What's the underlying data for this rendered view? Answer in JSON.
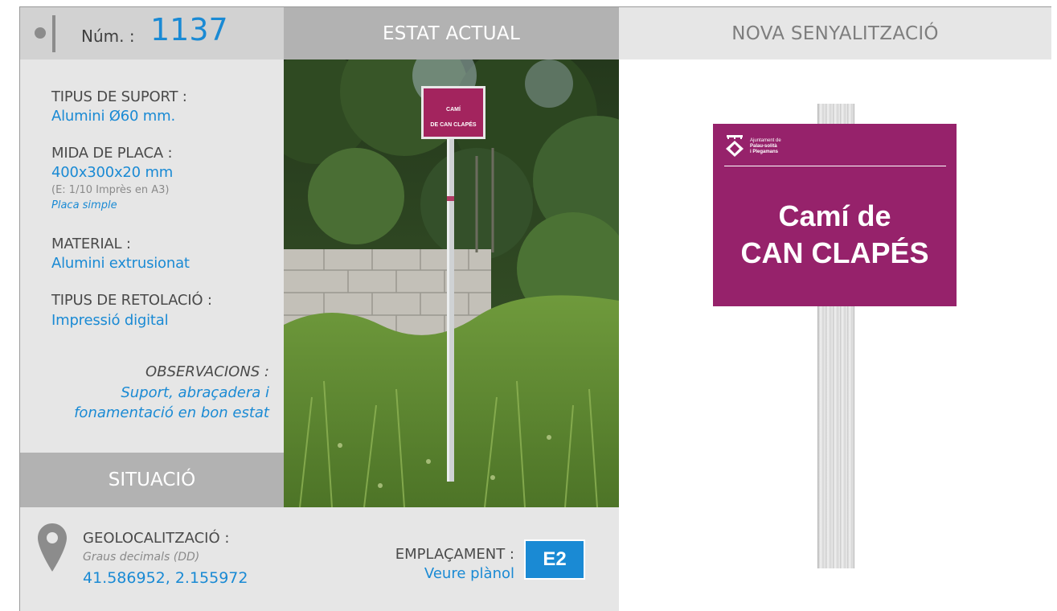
{
  "header": {
    "num_label": "Núm. :",
    "num_value": "1137",
    "estat_actual": "ESTAT ACTUAL",
    "nova_senyalitzacio": "NOVA SENYALITZACIÓ"
  },
  "fields": {
    "suport_label": "TIPUS DE SUPORT :",
    "suport_value": "Alumini Ø60 mm.",
    "mida_label": "MIDA DE PLACA :",
    "mida_value": "400x300x20 mm",
    "mida_note": "(E: 1/10 Imprès en A3)",
    "mida_type": "Placa simple",
    "material_label": "MATERIAL :",
    "material_value": "Alumini extrusionat",
    "retolacio_label": "TIPUS DE RETOLACIÓ :",
    "retolacio_value": "Impressió digital",
    "observacions_label": "OBSERVACIONS :",
    "observacions_value": "Suport, abraçadera i fonamentació en bon estat"
  },
  "situacio": {
    "title": "SITUACIÓ",
    "geo_label": "GEOLOCALITZACIÓ :",
    "geo_note": "Graus decimals (DD)",
    "geo_value": "41.586952, 2.155972",
    "emplacament_label": "EMPLAÇAMENT :",
    "emplacament_value": "Veure plànol",
    "emplacament_code": "E2"
  },
  "photo": {
    "sign_line1": "CAMÍ",
    "sign_line2": "DE CAN CLAPÉS"
  },
  "plate": {
    "org_line1": "Ajuntament de",
    "org_line2": "Palau-solità",
    "org_line3": "i Plegamans",
    "line1": "Camí de",
    "line2": "CAN CLAPÉS"
  },
  "colors": {
    "accent_blue": "#1a8ad4",
    "plate_magenta": "#96226b",
    "header_grey": "#b2b2b2",
    "panel_grey": "#e6e6e6"
  },
  "icons": {
    "location": "map-pin-icon",
    "bullet": "dot-icon",
    "logo": "shield-icon"
  }
}
